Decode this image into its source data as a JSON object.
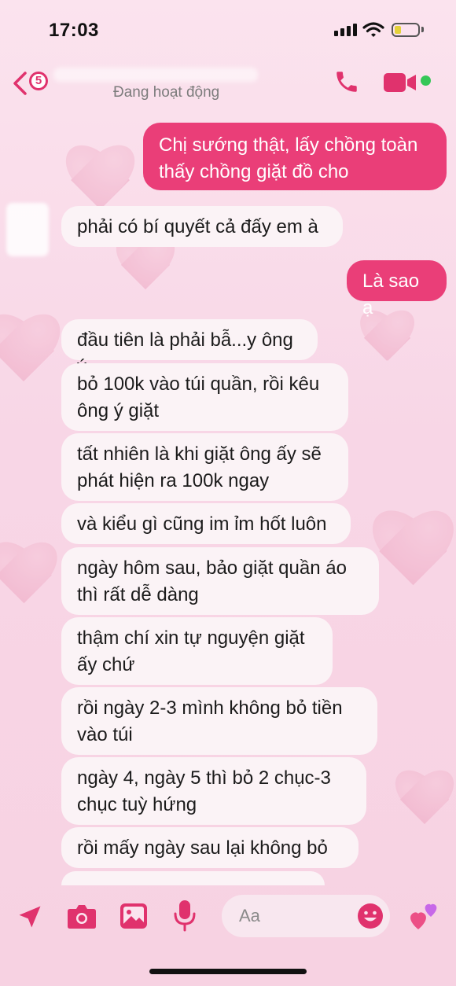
{
  "status_bar": {
    "time": "17:03"
  },
  "header": {
    "unread_count": "5",
    "active_status": "Đang hoạt động"
  },
  "messages": [
    {
      "dir": "out",
      "text": "Chị sướng thật, lấy chồng toàn thấy chồng giặt đồ cho"
    },
    {
      "dir": "in",
      "text": "phải có bí quyết cả đấy em à"
    },
    {
      "dir": "out",
      "text": "Là sao ạ"
    },
    {
      "dir": "in",
      "text": "đầu tiên là phải bẫ...y ông ý"
    },
    {
      "dir": "in",
      "text": "bỏ 100k vào túi quần, rồi kêu ông ý giặt"
    },
    {
      "dir": "in",
      "text": "tất nhiên là khi giặt ông ấy sẽ phát hiện ra 100k ngay"
    },
    {
      "dir": "in",
      "text": "và kiểu gì cũng im ỉm hốt luôn"
    },
    {
      "dir": "in",
      "text": "ngày hôm sau, bảo giặt quần áo thì rất dễ dàng"
    },
    {
      "dir": "in",
      "text": "thậm chí xin tự nguyện giặt ấy chứ"
    },
    {
      "dir": "in",
      "text": "rồi ngày 2-3 mình không bỏ tiền vào túi"
    },
    {
      "dir": "in",
      "text": "ngày 4, ngày 5 thì bỏ 2 chục-3 chục tuỳ hứng"
    },
    {
      "dir": "in",
      "text": "rồi mấy ngày sau lại không bỏ"
    }
  ],
  "composer": {
    "placeholder": "Aa"
  },
  "colors": {
    "accent": "#e0326d",
    "outgoing_bubble": "#ea3e78",
    "incoming_bubble": "#fbf3f6",
    "online": "#35c757"
  },
  "icons": [
    "back-chevron-icon",
    "phone-icon",
    "video-camera-icon",
    "location-arrow-icon",
    "camera-icon",
    "gallery-icon",
    "microphone-icon",
    "emoji-icon",
    "hearts-icon"
  ]
}
